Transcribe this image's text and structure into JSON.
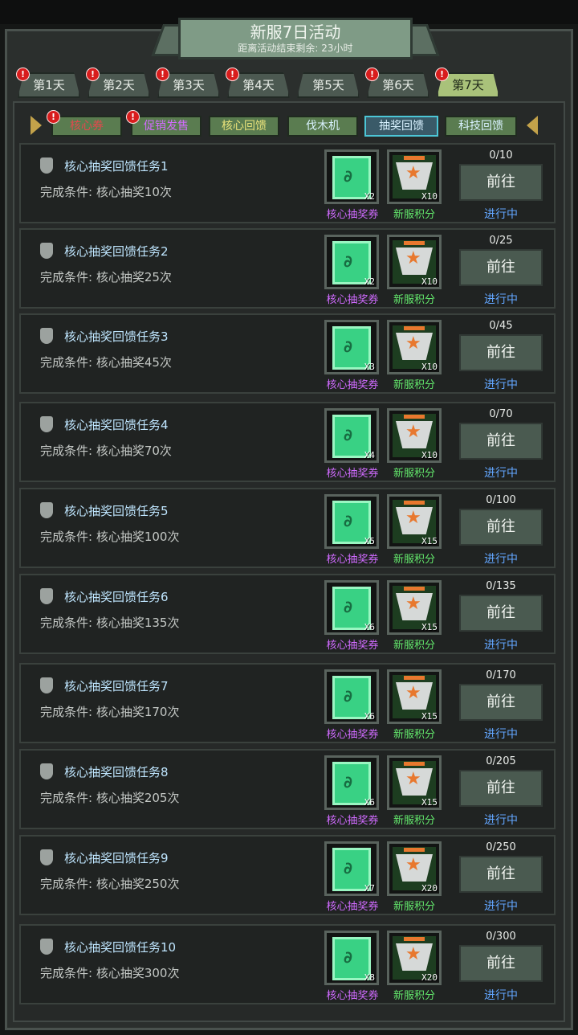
{
  "header": {
    "title": "新服7日活动",
    "subtitle": "距离活动结束剩余: 23小时"
  },
  "days": [
    {
      "label": "第1天",
      "alert": "!"
    },
    {
      "label": "第2天",
      "alert": "!"
    },
    {
      "label": "第3天",
      "alert": "!"
    },
    {
      "label": "第4天",
      "alert": "!"
    },
    {
      "label": "第5天",
      "alert": ""
    },
    {
      "label": "第6天",
      "alert": "!"
    },
    {
      "label": "第7天",
      "alert": "!"
    }
  ],
  "categories": [
    {
      "label": "核心券",
      "color": "#e0494d",
      "alert": "!"
    },
    {
      "label": "促销发售",
      "color": "#d36bff",
      "alert": "!"
    },
    {
      "label": "核心回馈",
      "color": "#e8e27a",
      "alert": ""
    },
    {
      "label": "伐木机",
      "color": "#d9f2ff",
      "alert": ""
    },
    {
      "label": "抽奖回馈",
      "color": "#d9f2ff",
      "alert": ""
    },
    {
      "label": "科技回馈",
      "color": "#d9f2ff",
      "alert": ""
    }
  ],
  "reward_labels": {
    "ticket": "核心抽奖券",
    "points": "新服积分"
  },
  "button_label": "前往",
  "tasks": [
    {
      "name": "核心抽奖回馈任务1",
      "condition": "完成条件: 核心抽奖10次",
      "ticket_qty": "X2",
      "points_qty": "X10",
      "progress": "0/10",
      "status": "进行中"
    },
    {
      "name": "核心抽奖回馈任务2",
      "condition": "完成条件: 核心抽奖25次",
      "ticket_qty": "X2",
      "points_qty": "X10",
      "progress": "0/25",
      "status": "进行中"
    },
    {
      "name": "核心抽奖回馈任务3",
      "condition": "完成条件: 核心抽奖45次",
      "ticket_qty": "X3",
      "points_qty": "X10",
      "progress": "0/45",
      "status": "进行中"
    },
    {
      "name": "核心抽奖回馈任务4",
      "condition": "完成条件: 核心抽奖70次",
      "ticket_qty": "X4",
      "points_qty": "X10",
      "progress": "0/70",
      "status": "进行中"
    },
    {
      "name": "核心抽奖回馈任务5",
      "condition": "完成条件: 核心抽奖100次",
      "ticket_qty": "X5",
      "points_qty": "X15",
      "progress": "0/100",
      "status": "进行中"
    },
    {
      "name": "核心抽奖回馈任务6",
      "condition": "完成条件: 核心抽奖135次",
      "ticket_qty": "X6",
      "points_qty": "X15",
      "progress": "0/135",
      "status": "进行中"
    },
    {
      "name": "核心抽奖回馈任务7",
      "condition": "完成条件: 核心抽奖170次",
      "ticket_qty": "X6",
      "points_qty": "X15",
      "progress": "0/170",
      "status": "进行中"
    },
    {
      "name": "核心抽奖回馈任务8",
      "condition": "完成条件: 核心抽奖205次",
      "ticket_qty": "X6",
      "points_qty": "X15",
      "progress": "0/205",
      "status": "进行中"
    },
    {
      "name": "核心抽奖回馈任务9",
      "condition": "完成条件: 核心抽奖250次",
      "ticket_qty": "X7",
      "points_qty": "X20",
      "progress": "0/250",
      "status": "进行中"
    },
    {
      "name": "核心抽奖回馈任务10",
      "condition": "完成条件: 核心抽奖300次",
      "ticket_qty": "X8",
      "points_qty": "X20",
      "progress": "0/300",
      "status": "进行中"
    }
  ]
}
